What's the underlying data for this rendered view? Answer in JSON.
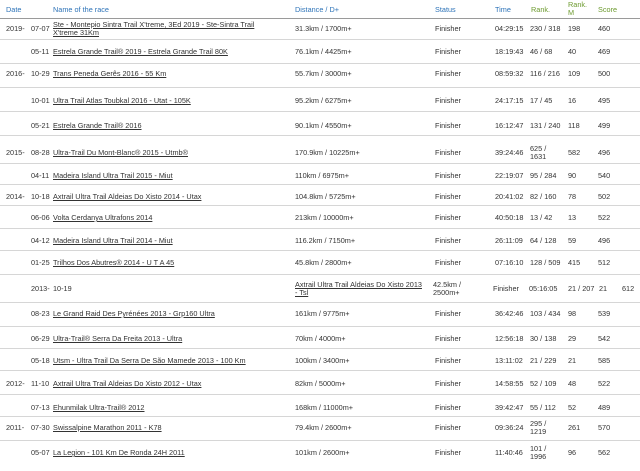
{
  "header": {
    "date": "Date",
    "name": "Name of the race",
    "distance": "Distance / D+",
    "status": "Status",
    "time": "Time",
    "rank": "Rank.",
    "rank_m_1": "Rank.",
    "rank_m_2": "M",
    "score": "Score"
  },
  "rows": [
    {
      "year": "2019-",
      "md": "07-07",
      "name_lines": [
        "Ste - Montepio Sintra Trail X'treme, 3Ed 2019 - Ste-Sintra Trail",
        "X'treme 31Km"
      ],
      "dist_lines": [
        "31.3km / 1700m+"
      ],
      "status": "Finisher",
      "time": "04:29:15",
      "rank_lines": [
        "230 / 318"
      ],
      "rank_m": "198",
      "score": "460"
    },
    {
      "year": "",
      "md": "05-11",
      "name_lines": [
        "Estrela Grande Trail® 2019 - Estrela Grande Trail 80K"
      ],
      "dist_lines": [
        "76.1km / 4425m+"
      ],
      "status": "Finisher",
      "time": "18:19:43",
      "rank_lines": [
        "46 / 68"
      ],
      "rank_m": "40",
      "score": "469"
    },
    {
      "year": "2016-",
      "md": "10-29",
      "name_lines": [
        "Trans Peneda Gerês 2016 - 55 Km"
      ],
      "dist_lines": [
        "55.7km / 3000m+"
      ],
      "status": "Finisher",
      "time": "08:59:32",
      "rank_lines": [
        "116 / 216"
      ],
      "rank_m": "109",
      "score": "500"
    },
    {
      "year": "",
      "md": "10-01",
      "name_lines": [
        "Ultra Trail Atlas Toubkal 2016 - Utat - 105K"
      ],
      "dist_lines": [
        "95.2km / 6275m+"
      ],
      "status": "Finisher",
      "time": "24:17:15",
      "rank_lines": [
        "17 / 45"
      ],
      "rank_m": "16",
      "score": "495"
    },
    {
      "year": "",
      "md": "05-21",
      "name_lines": [
        "Estrela Grande Trail® 2016"
      ],
      "dist_lines": [
        "90.1km / 4550m+"
      ],
      "status": "Finisher",
      "time": "16:12:47",
      "rank_lines": [
        "131 / 240"
      ],
      "rank_m": "118",
      "score": "499"
    },
    {
      "year": "2015-",
      "md": "08-28",
      "name_lines": [
        "Ultra-Trail Du Mont-Blanc® 2015 - Utmb®"
      ],
      "dist_lines": [
        "170.9km / 10225m+"
      ],
      "status": "Finisher",
      "time": "39:24:46",
      "rank_lines": [
        "625 /",
        "1631"
      ],
      "rank_m": "582",
      "score": "496"
    },
    {
      "year": "",
      "md": "04-11",
      "name_lines": [
        "Madeira Island Ultra Trail 2015 - Miut"
      ],
      "dist_lines": [
        "110km / 6975m+"
      ],
      "status": "Finisher",
      "time": "22:19:07",
      "rank_lines": [
        "95 / 284"
      ],
      "rank_m": "90",
      "score": "540"
    },
    {
      "year": "2014-",
      "md": "10-18",
      "name_lines": [
        "Axtrail Ultra Trail Aldeias Do Xisto 2014 - Utax"
      ],
      "dist_lines": [
        "104.8km / 5725m+"
      ],
      "status": "Finisher",
      "time": "20:41:02",
      "rank_lines": [
        "82 / 160"
      ],
      "rank_m": "78",
      "score": "502"
    },
    {
      "year": "",
      "md": "06-06",
      "name_lines": [
        "Volta Cerdanya Ultrafons 2014"
      ],
      "dist_lines": [
        "213km / 10000m+"
      ],
      "status": "Finisher",
      "time": "40:50:18",
      "rank_lines": [
        "13 / 42"
      ],
      "rank_m": "13",
      "score": "522"
    },
    {
      "year": "",
      "md": "04-12",
      "name_lines": [
        "Madeira Island Ultra Trail 2014 - Miut"
      ],
      "dist_lines": [
        "116.2km / 7150m+"
      ],
      "status": "Finisher",
      "time": "26:11:09",
      "rank_lines": [
        "64 / 128"
      ],
      "rank_m": "59",
      "score": "496"
    },
    {
      "year": "",
      "md": "01-25",
      "name_lines": [
        "Trilhos Dos Abutres® 2014 - U T A 45"
      ],
      "dist_lines": [
        "45.8km / 2800m+"
      ],
      "status": "Finisher",
      "time": "07:16:10",
      "rank_lines": [
        "128 / 509"
      ],
      "rank_m": "415",
      "score": "512"
    },
    {
      "year": "2013-",
      "md": "10-19",
      "name_lines": [
        "Axtrail Ultra Trail Aldeias Do Xisto 2013",
        "- Tsl"
      ],
      "dist_lines": [
        "42.5km /",
        "2500m+"
      ],
      "status": "Finisher",
      "time": "05:16:05",
      "rank_lines": [
        "21 / 207"
      ],
      "rank_m": "21",
      "score": "612"
    },
    {
      "year": "",
      "md": "08-23",
      "name_lines": [
        "Le Grand Raid Des Pyrénées 2013 - Grp160 Ultra"
      ],
      "dist_lines": [
        "161km / 9775m+"
      ],
      "status": "Finisher",
      "time": "36:42:46",
      "rank_lines": [
        "103 / 434"
      ],
      "rank_m": "98",
      "score": "539"
    },
    {
      "year": "",
      "md": "06-29",
      "name_lines": [
        "Ultra-Trail® Serra Da Freita 2013 - Ultra"
      ],
      "dist_lines": [
        "70km / 4000m+"
      ],
      "status": "Finisher",
      "time": "12:56:18",
      "rank_lines": [
        "30 / 138"
      ],
      "rank_m": "29",
      "score": "542"
    },
    {
      "year": "",
      "md": "05-18",
      "name_lines": [
        "Utsm - Ultra Trail Da Serra De São Mamede 2013 - 100 Km"
      ],
      "dist_lines": [
        "100km / 3400m+"
      ],
      "status": "Finisher",
      "time": "13:11:02",
      "rank_lines": [
        "21 / 229"
      ],
      "rank_m": "21",
      "score": "585"
    },
    {
      "year": "2012-",
      "md": "11-10",
      "name_lines": [
        "Axtrail Ultra Trail Aldeias Do Xisto 2012 - Utax"
      ],
      "dist_lines": [
        "82km / 5000m+"
      ],
      "status": "Finisher",
      "time": "14:58:55",
      "rank_lines": [
        "52 / 109"
      ],
      "rank_m": "48",
      "score": "522"
    },
    {
      "year": "",
      "md": "07-13",
      "name_lines": [
        "Ehunmilak Ultra-Trail® 2012"
      ],
      "dist_lines": [
        "168km / 11000m+"
      ],
      "status": "Finisher",
      "time": "39:42:47",
      "rank_lines": [
        "55 / 112"
      ],
      "rank_m": "52",
      "score": "489"
    },
    {
      "year": "2011-",
      "md": "07-30",
      "name_lines": [
        "Swissalpine Marathon 2011 - K78"
      ],
      "dist_lines": [
        "79.4km / 2600m+"
      ],
      "status": "Finisher",
      "time": "09:36:24",
      "rank_lines": [
        "295 /",
        "1219"
      ],
      "rank_m": "261",
      "score": "570"
    },
    {
      "year": "",
      "md": "05-07",
      "name_lines": [
        "La Legion - 101 Km De Ronda 24H 2011"
      ],
      "dist_lines": [
        "101km / 2600m+"
      ],
      "status": "Finisher",
      "time": "11:40:46",
      "rank_lines": [
        "101 /",
        "1996"
      ],
      "rank_m": "96",
      "score": "562"
    }
  ]
}
